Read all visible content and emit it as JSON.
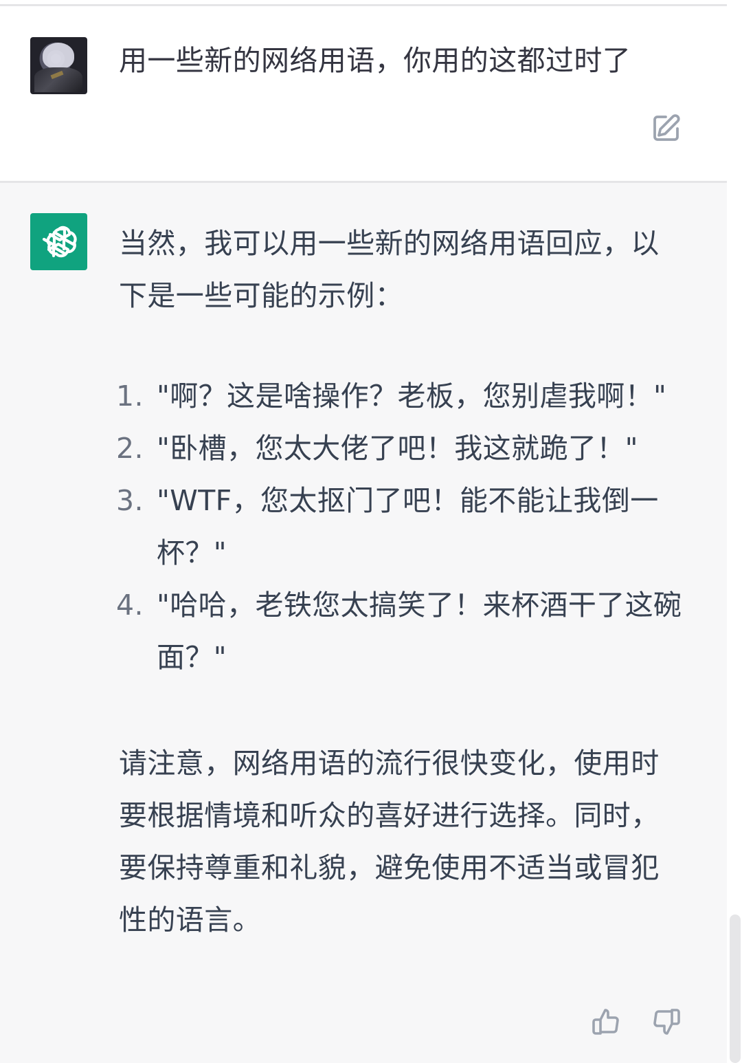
{
  "conversation": {
    "user_message": "用一些新的网络用语，你用的这都过时了",
    "assistant": {
      "intro": "当然，我可以用一些新的网络用语回应，以下是一些可能的示例：",
      "examples": [
        {
          "number": "1.",
          "text": "\"啊？这是啥操作？老板，您别虐我啊！\""
        },
        {
          "number": "2.",
          "text": "\"卧槽，您太大佬了吧！我这就跪了！\""
        },
        {
          "number": "3.",
          "text": "\"WTF，您太抠门了吧！能不能让我倒一杯？\""
        },
        {
          "number": "4.",
          "text": "\"哈哈，老铁您太搞笑了！来杯酒干了这碗面？\""
        }
      ],
      "note": "请注意，网络用语的流行很快变化，使用时要根据情境和听众的喜好进行选择。同时，要保持尊重和礼貌，避免使用不适当或冒犯性的语言。"
    }
  },
  "icons": {
    "edit": "edit-icon",
    "assistant_logo": "openai-logo-icon",
    "thumbs_up": "thumbs-up-icon",
    "thumbs_down": "thumbs-down-icon"
  },
  "colors": {
    "assistant_background": "#f7f7f8",
    "assistant_avatar": "#10a37f",
    "text": "#374151",
    "icon": "#9ca3af",
    "divider": "#e5e5e7"
  }
}
